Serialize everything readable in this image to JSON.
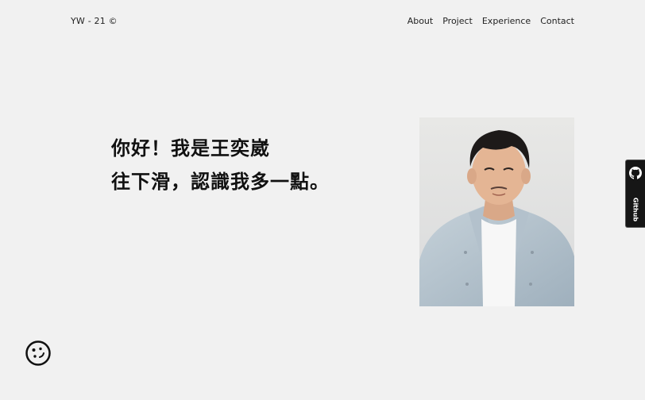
{
  "header": {
    "brand": "YW - 21 ©",
    "nav": [
      {
        "label": "About"
      },
      {
        "label": "Project"
      },
      {
        "label": "Experience"
      },
      {
        "label": "Contact"
      }
    ]
  },
  "hero": {
    "greeting_prefix": "你好！我是",
    "name": "王奕崴",
    "line2": "往下滑，認識我多一點。"
  },
  "side_tab": {
    "label": "Github",
    "icon": "github-icon"
  },
  "cookie": {
    "icon": "cookie-icon"
  },
  "colors": {
    "background": "#f1f1f1",
    "highlight": "#f15763",
    "text": "#111111",
    "tab": "#161616"
  }
}
